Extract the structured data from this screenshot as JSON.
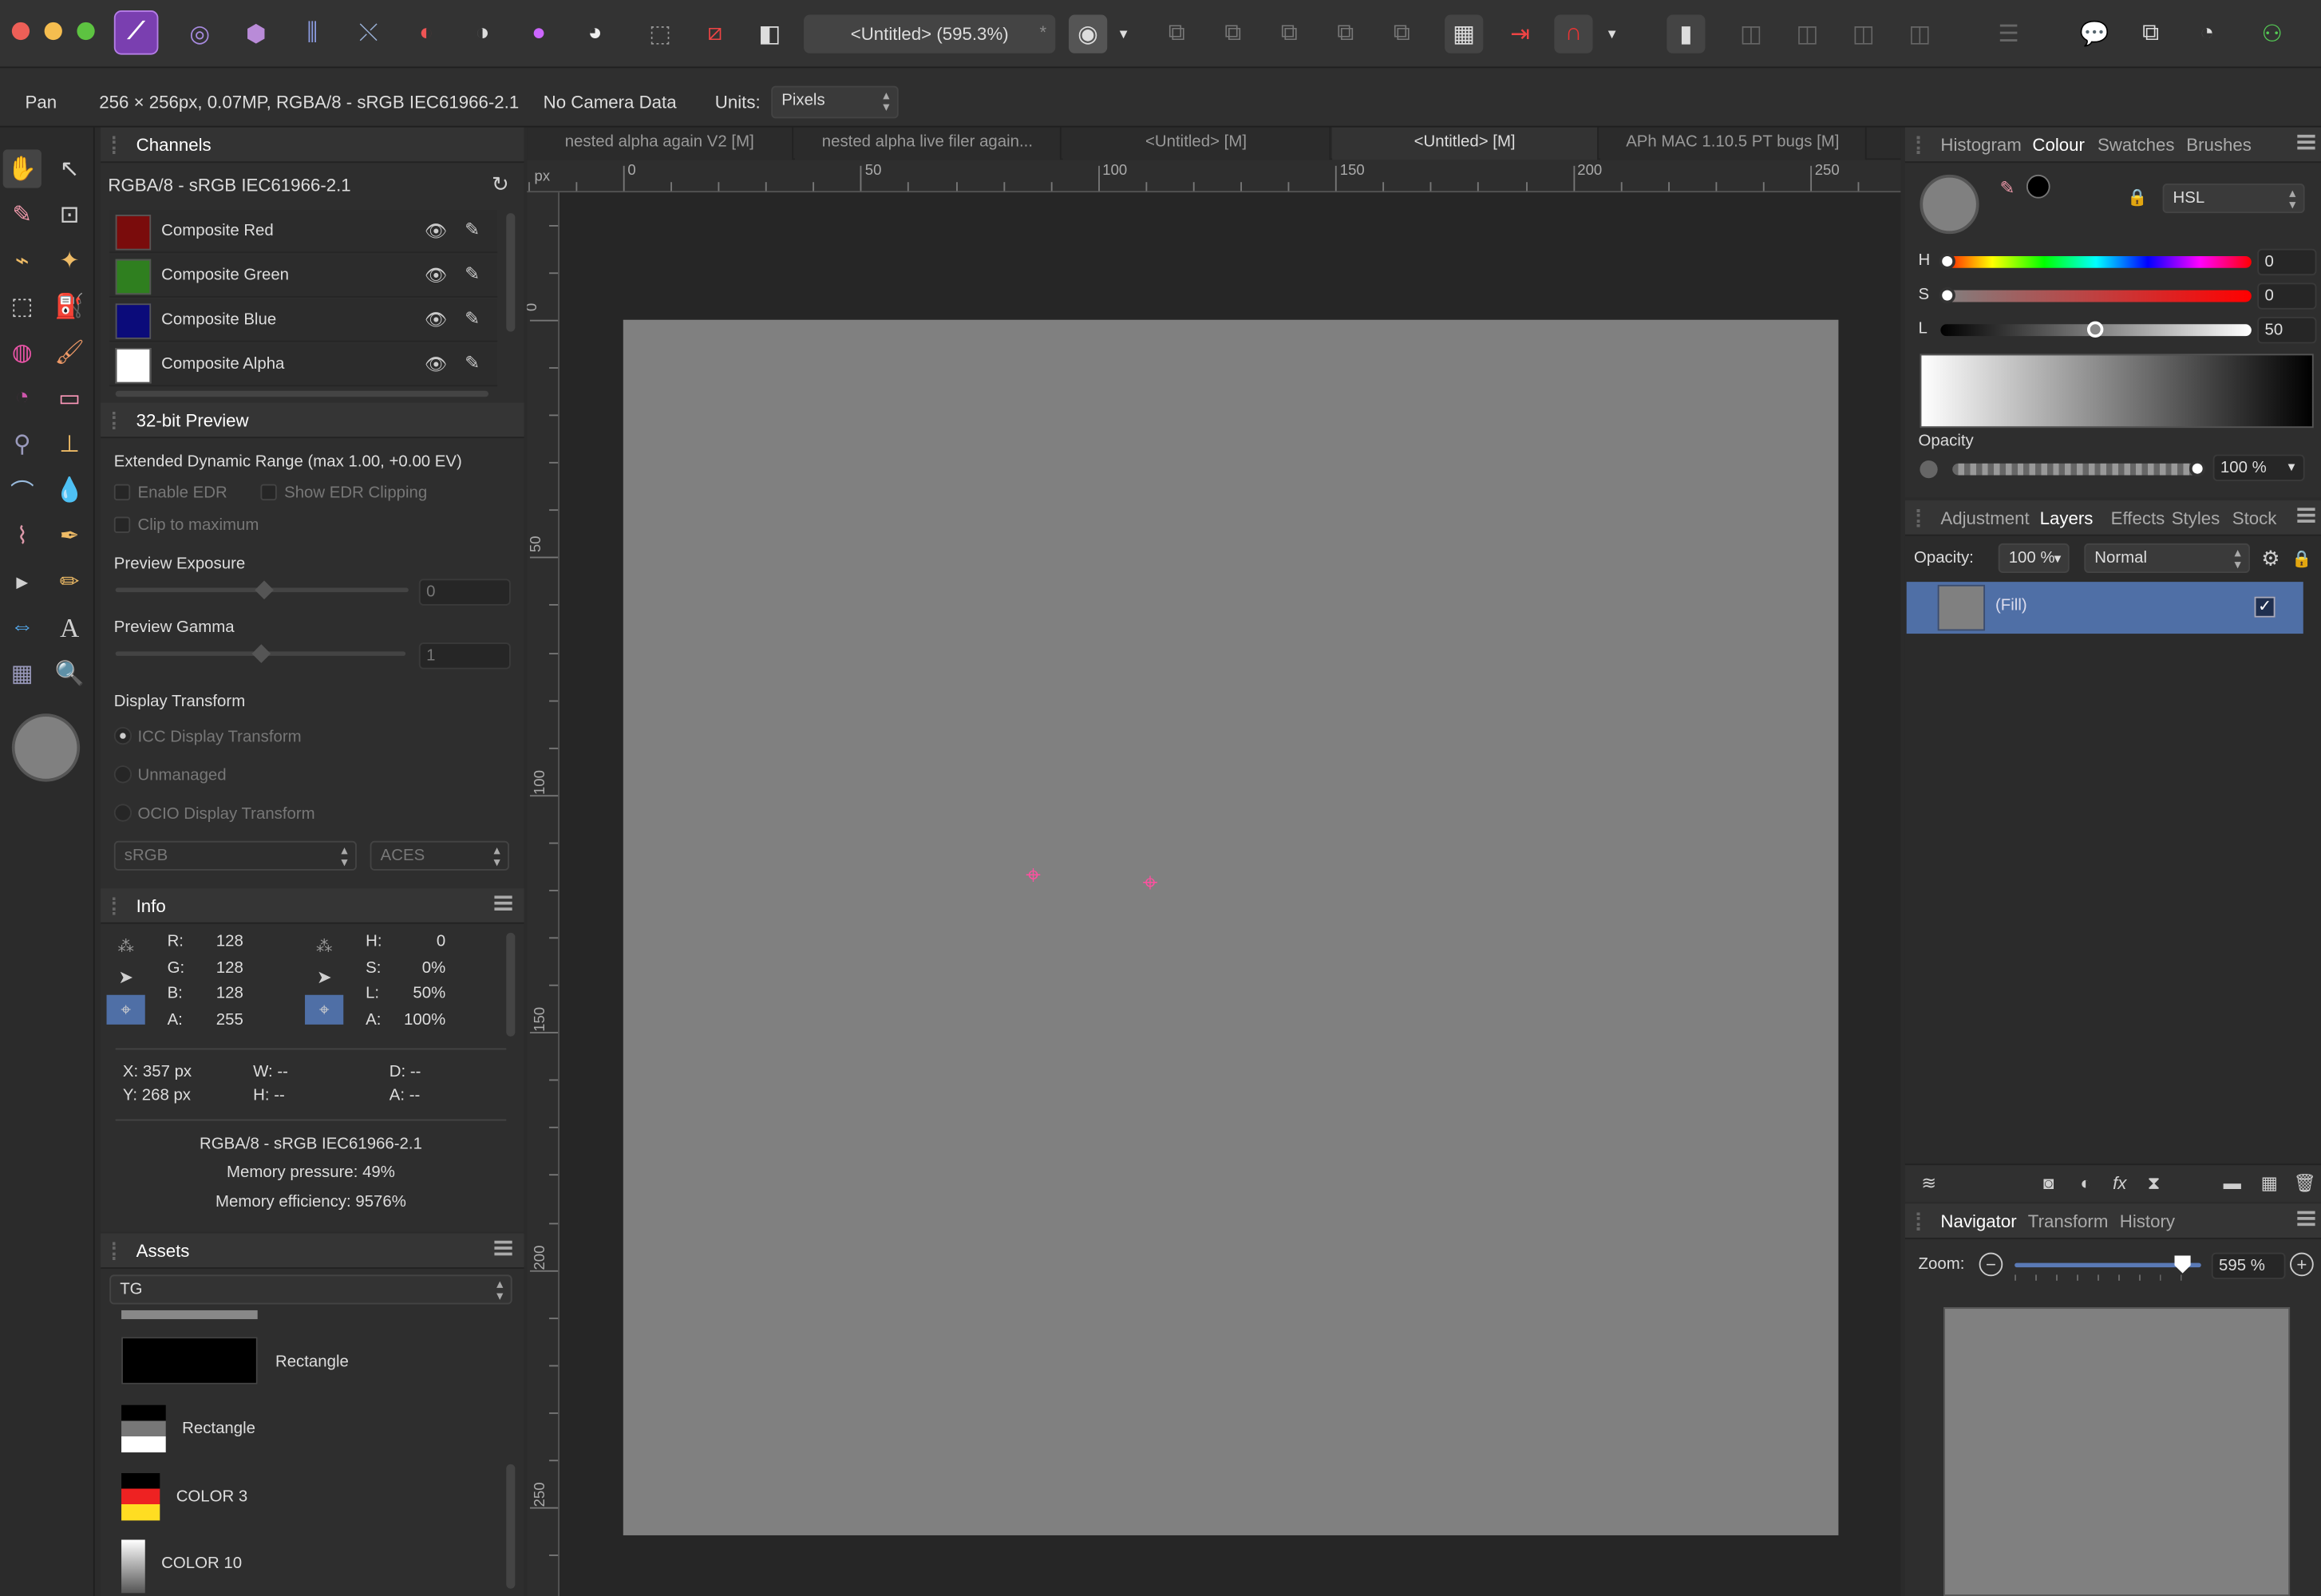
{
  "toolbar": {
    "title": "<Untitled> (595.3%)",
    "title_star": "*"
  },
  "context": {
    "tool": "Pan",
    "doc_info": "256 × 256px, 0.07MP, RGBA/8 - sRGB IEC61966-2.1",
    "camera": "No Camera Data",
    "units_label": "Units:",
    "units_value": "Pixels"
  },
  "doc_tabs": [
    "nested alpha again V2 [M]",
    "nested alpha live filer again...",
    "<Untitled> [M]",
    "<Untitled> [M]",
    "APh MAC 1.10.5 PT bugs [M]"
  ],
  "ruler": {
    "unit": "px",
    "h_labels": [
      "0",
      "50",
      "100",
      "150",
      "200",
      "250"
    ],
    "v_labels": [
      "0",
      "50",
      "100",
      "150",
      "200",
      "250"
    ]
  },
  "channels": {
    "tab": "Channels",
    "profile": "RGBA/8 - sRGB IEC61966-2.1",
    "items": [
      {
        "label": "Composite Red",
        "color": "#7a0c0c"
      },
      {
        "label": "Composite Green",
        "color": "#2f7f1f"
      },
      {
        "label": "Composite Blue",
        "color": "#0b0b7a"
      },
      {
        "label": "Composite Alpha",
        "color": "#ffffff"
      }
    ]
  },
  "preview32": {
    "tab": "32-bit Preview",
    "edr": "Extended Dynamic Range (max 1.00, +0.00 EV)",
    "enable_edr": "Enable EDR",
    "show_clip": "Show EDR Clipping",
    "clip_max": "Clip to maximum",
    "exposure_label": "Preview Exposure",
    "exposure_value": "0",
    "gamma_label": "Preview Gamma",
    "gamma_value": "1",
    "transform_label": "Display Transform",
    "icc": "ICC Display Transform",
    "unmanaged": "Unmanaged",
    "ocio": "OCIO Display Transform",
    "ocio_a": "sRGB",
    "ocio_b": "ACES"
  },
  "info": {
    "tab": "Info",
    "rgb": [
      [
        "R:",
        "128"
      ],
      [
        "G:",
        "128"
      ],
      [
        "B:",
        "128"
      ],
      [
        "A:",
        "255"
      ]
    ],
    "hsl": [
      [
        "H:",
        "0"
      ],
      [
        "S:",
        "0%"
      ],
      [
        "L:",
        "50%"
      ],
      [
        "A:",
        "100%"
      ]
    ],
    "x": "X: 357 px",
    "y": "Y: 268 px",
    "w": "W: --",
    "h": "H: --",
    "d": "D: --",
    "a": "A: --",
    "profile": "RGBA/8 - sRGB IEC61966-2.1",
    "mem_pressure": "Memory pressure: 49%",
    "mem_eff": "Memory efficiency: 9576%"
  },
  "assets": {
    "tab": "Assets",
    "category": "TG",
    "items": [
      "Rectangle",
      "Rectangle",
      "COLOR 3",
      "COLOR 10"
    ]
  },
  "colour_panel": {
    "tabs": [
      "Histogram",
      "Colour",
      "Swatches",
      "Brushes"
    ],
    "mode": "HSL",
    "h_label": "H",
    "h_value": "0",
    "s_label": "S",
    "s_value": "0",
    "l_label": "L",
    "l_value": "50",
    "opacity_label": "Opacity",
    "opacity_value": "100 %"
  },
  "layers_panel": {
    "tabs": [
      "Adjustment",
      "Layers",
      "Effects",
      "Styles",
      "Stock"
    ],
    "opacity_label": "Opacity:",
    "opacity_value": "100 %",
    "blend": "Normal",
    "layer_name": "(Fill)"
  },
  "navigator": {
    "tabs": [
      "Navigator",
      "Transform",
      "History"
    ],
    "zoom_label": "Zoom:",
    "zoom_value": "595 %"
  },
  "colors": {
    "canvas_fill": "#808080",
    "accent": "#4f6fa6",
    "target": "#ff4fa0"
  }
}
